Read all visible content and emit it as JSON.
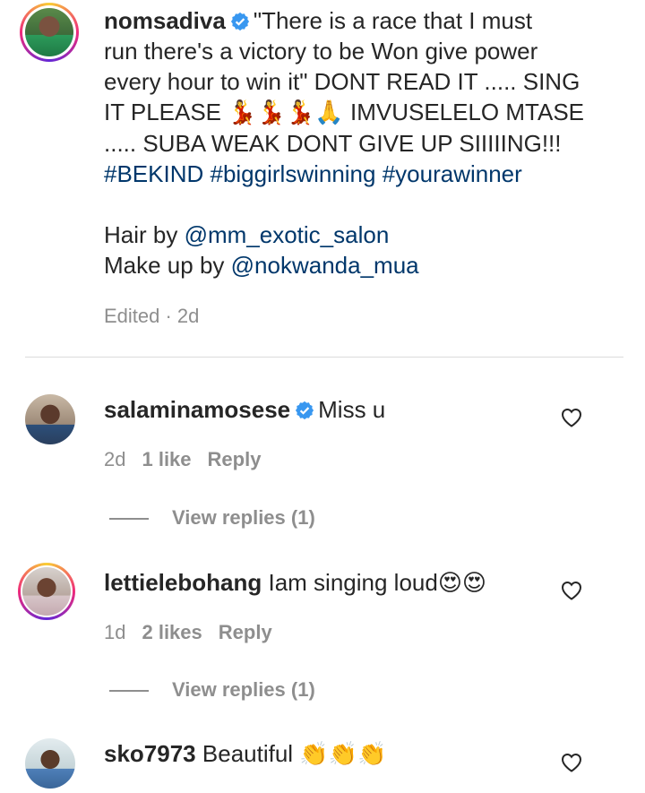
{
  "caption": {
    "username": "nomsadiva",
    "text_line1": "\"There is a race that I must",
    "text_line2": "run there's a victory to be Won give power",
    "text_line3": "every hour to win it\" DONT READ IT ..... SING",
    "text_line4a": "IT PLEASE ",
    "text_line4_emoji": "💃💃💃🙏",
    "text_line4b": " IMVUSELELO MTASE",
    "text_line5": "..... SUBA WEAK DONT GIVE UP SIIIIING!!!",
    "hashtags": "#BEKIND #biggirlswinning #yourawinner",
    "hair_label": "Hair by ",
    "hair_mention": "@mm_exotic_salon",
    "makeup_label": "Make up by ",
    "makeup_mention": "@nokwanda_mua",
    "meta": "Edited · 2d"
  },
  "comments": [
    {
      "username": "salaminamosese",
      "verified": true,
      "text": "Miss u",
      "time": "2d",
      "likes": "1 like",
      "reply": "Reply",
      "view_replies": "View replies (1)"
    },
    {
      "username": "lettielebohang",
      "verified": false,
      "text": "Iam singing loud",
      "emoji": "😍😍",
      "time": "1d",
      "likes": "2 likes",
      "reply": "Reply",
      "view_replies": "View replies (1)"
    },
    {
      "username": "sko7973",
      "verified": false,
      "text": "Beautiful ",
      "emoji": "👏👏👏"
    }
  ],
  "colors": {
    "link": "#00376b",
    "verified": "#3897f0",
    "meta": "#8e8e8e",
    "text": "#262626"
  },
  "icons": [
    "verified-badge-icon",
    "heart-icon"
  ]
}
